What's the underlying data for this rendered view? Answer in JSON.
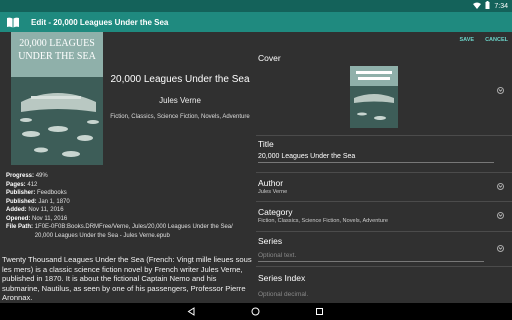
{
  "status_bar": {
    "time": "7:34"
  },
  "app_bar": {
    "title": "Edit - 20,000 Leagues Under the Sea"
  },
  "book": {
    "title": "20,000 Leagues Under the Sea",
    "author": "Jules Verne",
    "genres": "Fiction, Classics, Science Fiction, Novels, Adventure",
    "cover_text": {
      "line1": "20,000 LEAGUES",
      "line2": "UNDER THE SEA"
    }
  },
  "meta": [
    {
      "label": "Progress:",
      "value": "49%"
    },
    {
      "label": "Pages:",
      "value": "412"
    },
    {
      "label": "Publisher:",
      "value": "Feedbooks"
    },
    {
      "label": "Published:",
      "value": "Jan 1, 1870"
    },
    {
      "label": "Added:",
      "value": "Nov 11, 2016"
    },
    {
      "label": "Opened:",
      "value": "Nov 11, 2016"
    },
    {
      "label": "File Path:",
      "value": "1F0E-0F0B:Books.DRMFree/Verne, Jules/20,000 Leagues Under the Sea/ 20,000 Leagues Under the Sea - Jules Verne.epub"
    }
  ],
  "description": "Twenty Thousand Leagues Under the Sea (French: Vingt mille lieues sous les mers) is a classic science fiction novel by French writer Jules Verne, published in 1870. It is about the fictional Captain Nemo and his submarine, Nautilus, as seen by one of his passengers, Professor Pierre Aronnax.",
  "actions": {
    "save": "SAVE",
    "cancel": "CANCEL"
  },
  "form": {
    "cover_label": "Cover",
    "title_label": "Title",
    "title_value": "20,000 Leagues Under the Sea",
    "author_label": "Author",
    "author_value": "Jules Verne",
    "category_label": "Category",
    "category_value": "Fiction, Classics, Science Fiction, Novels, Adventure",
    "series_label": "Series",
    "series_placeholder": "Optional text.",
    "series_index_label": "Series Index",
    "series_index_placeholder": "Optional decimal."
  },
  "colors": {
    "app_bar": "#1f8a7f",
    "status_bar": "#14625a",
    "accent": "#6bd3c8",
    "background": "#303030"
  },
  "icons": [
    "book-icon",
    "wifi-icon",
    "battery-icon",
    "chevron-down-icon",
    "back-icon",
    "home-icon",
    "recents-icon"
  ]
}
